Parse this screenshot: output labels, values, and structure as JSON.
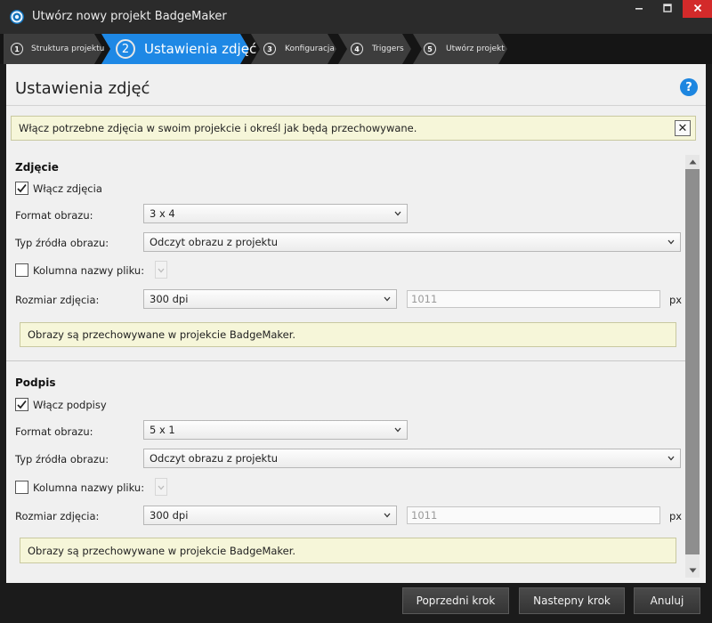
{
  "window": {
    "title": "Utwórz nowy projekt BadgeMaker",
    "app_icon": "badgemaker-logo-icon",
    "controls": [
      "minimize-icon",
      "maximize-icon",
      "close-icon"
    ]
  },
  "wizard_steps": [
    {
      "number": "1",
      "label": "Struktura projektu",
      "active": false
    },
    {
      "number": "2",
      "label": "Ustawienia zdjęć",
      "active": true
    },
    {
      "number": "3",
      "label": "Konfiguracja",
      "active": false
    },
    {
      "number": "4",
      "label": "Triggers",
      "active": false
    },
    {
      "number": "5",
      "label": "Utwórz projekt",
      "active": false
    }
  ],
  "page": {
    "title": "Ustawienia zdjęć",
    "help_label": "?",
    "info_note": "Włącz potrzebne zdjęcia w swoim projekcie i określ jak będą przechowywane.",
    "close_label": "✕"
  },
  "photo_section": {
    "title": "Zdjęcie",
    "enable_label": "Włącz zdjęcia",
    "enable_checked": true,
    "format_label": "Format obrazu:",
    "format_value": "3 x 4",
    "source_label": "Typ źródła obrazu:",
    "source_value": "Odczyt obrazu z projektu",
    "filename_col_label": "Kolumna nazwy pliku:",
    "filename_col_checked": false,
    "size_label": "Rozmiar zdjęcia:",
    "size_value": "300 dpi",
    "size_px": "1011",
    "unit": "px",
    "storage_note": "Obrazy są przechowywane w projekcie BadgeMaker."
  },
  "signature_section": {
    "title": "Podpis",
    "enable_label": "Włącz podpisy",
    "enable_checked": true,
    "format_label": "Format obrazu:",
    "format_value": "5 x 1",
    "source_label": "Typ źródła obrazu:",
    "source_value": "Odczyt obrazu z projektu",
    "filename_col_label": "Kolumna nazwy pliku:",
    "filename_col_checked": false,
    "size_label": "Rozmiar zdjęcia:",
    "size_value": "300 dpi",
    "size_px": "1011",
    "unit": "px",
    "storage_note": "Obrazy są przechowywane w projekcie BadgeMaker."
  },
  "footer": {
    "prev_label": "Poprzedni krok",
    "next_label": "Nastepny krok",
    "cancel_label": "Anuluj"
  },
  "colors": {
    "titlebar": "#2b2b2b",
    "active_step": "#1e88e5",
    "inactive_step": "#3d3d3d",
    "close_button": "#d32a2a",
    "note_background": "#f6f6d9",
    "panel": "#f0f0f0"
  }
}
